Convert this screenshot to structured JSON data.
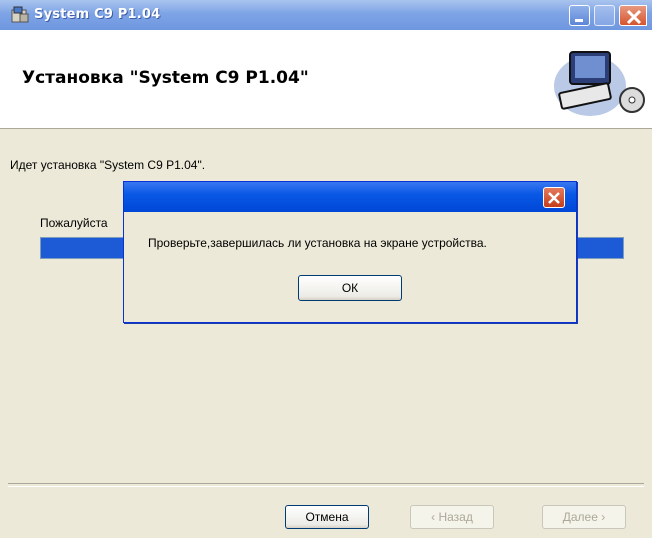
{
  "window": {
    "title": "System C9 P1.04"
  },
  "banner": {
    "title": "Установка \"System C9 P1.04\""
  },
  "body": {
    "status_text": "Идет установка \"System C9 P1.04\".",
    "please_wait": "Пожалуйста",
    "progress_fraction": 1.0
  },
  "buttons": {
    "cancel": "Отмена",
    "back": "‹ Назад",
    "next": "Далее ›"
  },
  "dialog": {
    "message": "Проверьте,завершилась ли установка на экране устройства.",
    "ok": "ОК"
  },
  "colors": {
    "progress": "#1c5ad6",
    "titlebar": "#0047d6",
    "close": "#c43d1a"
  }
}
